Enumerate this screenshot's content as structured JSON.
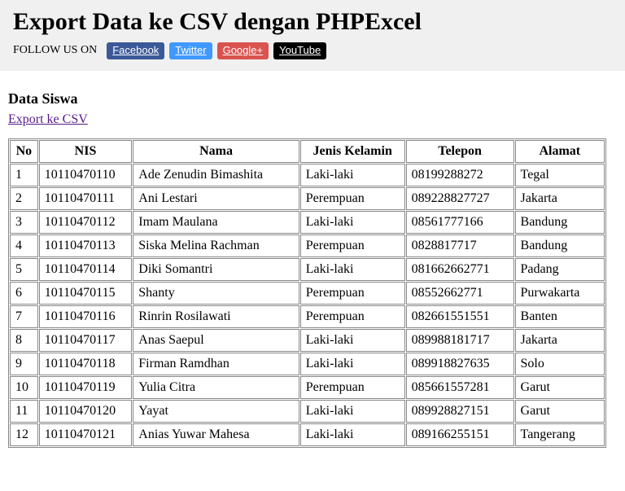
{
  "header": {
    "title": "Export Data ke CSV dengan PHPExcel",
    "follow_label": "FOLLOW US ON",
    "social": {
      "facebook": "Facebook",
      "twitter": "Twitter",
      "googleplus": "Google+",
      "youtube": "YouTube"
    }
  },
  "subtitle": "Data Siswa",
  "export_link": "Export ke CSV",
  "table": {
    "headers": {
      "no": "No",
      "nis": "NIS",
      "nama": "Nama",
      "jk": "Jenis Kelamin",
      "tel": "Telepon",
      "almt": "Alamat"
    },
    "rows": [
      {
        "no": "1",
        "nis": "10110470110",
        "nama": "Ade Zenudin Bimashita",
        "jk": "Laki-laki",
        "tel": "08199288272",
        "almt": "Tegal"
      },
      {
        "no": "2",
        "nis": "10110470111",
        "nama": "Ani Lestari",
        "jk": "Perempuan",
        "tel": "089228827727",
        "almt": "Jakarta"
      },
      {
        "no": "3",
        "nis": "10110470112",
        "nama": "Imam Maulana",
        "jk": "Laki-laki",
        "tel": "08561777166",
        "almt": "Bandung"
      },
      {
        "no": "4",
        "nis": "10110470113",
        "nama": "Siska Melina Rachman",
        "jk": "Perempuan",
        "tel": "0828817717",
        "almt": "Bandung"
      },
      {
        "no": "5",
        "nis": "10110470114",
        "nama": "Diki Somantri",
        "jk": "Laki-laki",
        "tel": "081662662771",
        "almt": "Padang"
      },
      {
        "no": "6",
        "nis": "10110470115",
        "nama": "Shanty",
        "jk": "Perempuan",
        "tel": "08552662771",
        "almt": "Purwakarta"
      },
      {
        "no": "7",
        "nis": "10110470116",
        "nama": "Rinrin Rosilawati",
        "jk": "Perempuan",
        "tel": "082661551551",
        "almt": "Banten"
      },
      {
        "no": "8",
        "nis": "10110470117",
        "nama": "Anas Saepul",
        "jk": "Laki-laki",
        "tel": "089988181717",
        "almt": "Jakarta"
      },
      {
        "no": "9",
        "nis": "10110470118",
        "nama": "Firman Ramdhan",
        "jk": "Laki-laki",
        "tel": "089918827635",
        "almt": "Solo"
      },
      {
        "no": "10",
        "nis": "10110470119",
        "nama": "Yulia Citra",
        "jk": "Perempuan",
        "tel": "085661557281",
        "almt": "Garut"
      },
      {
        "no": "11",
        "nis": "10110470120",
        "nama": "Yayat",
        "jk": "Laki-laki",
        "tel": "089928827151",
        "almt": "Garut"
      },
      {
        "no": "12",
        "nis": "10110470121",
        "nama": "Anias Yuwar Mahesa",
        "jk": "Laki-laki",
        "tel": "089166255151",
        "almt": "Tangerang"
      }
    ]
  }
}
